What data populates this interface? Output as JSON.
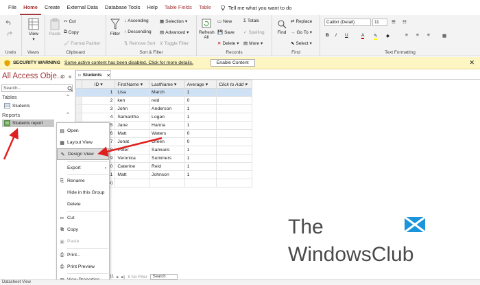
{
  "menu": {
    "items": [
      "File",
      "Home",
      "Create",
      "External Data",
      "Database Tools",
      "Help",
      "Table Fields",
      "Table"
    ],
    "active": "Home",
    "tell_me": "Tell me what you want to do"
  },
  "ribbon": {
    "undo": {
      "label": "Undo"
    },
    "views": {
      "view_label": "View",
      "label": "Views"
    },
    "clipboard": {
      "paste": "Paste",
      "cut": "Cut",
      "copy": "Copy",
      "format_painter": "Format Painter",
      "label": "Clipboard"
    },
    "sort_filter": {
      "filter": "Filter",
      "ascending": "Ascending",
      "descending": "Descending",
      "remove_sort": "Remove Sort",
      "selection": "Selection",
      "advanced": "Advanced",
      "toggle_filter": "Toggle Filter",
      "label": "Sort & Filter"
    },
    "records": {
      "refresh": "Refresh",
      "refresh_all": "All",
      "new": "New",
      "save": "Save",
      "delete": "Delete",
      "totals": "Totals",
      "spelling": "Spelling",
      "more": "More",
      "label": "Records"
    },
    "find": {
      "find": "Find",
      "replace": "Replace",
      "goto": "Go To",
      "select": "Select",
      "label": "Find"
    },
    "text_formatting": {
      "font": "Calibri (Detail)",
      "size": "11",
      "bold": "B",
      "italic": "I",
      "underline": "U",
      "font_color": "A",
      "label": "Text Formatting"
    }
  },
  "security": {
    "title": "SECURITY WARNING",
    "message": "Some active content has been disabled. Click for more details.",
    "enable_button": "Enable Content"
  },
  "nav": {
    "title": "All Access Obje...",
    "search_placeholder": "Search...",
    "groups": [
      {
        "name": "Tables",
        "items": [
          "Students"
        ]
      },
      {
        "name": "Reports",
        "items": [
          "Students report"
        ]
      }
    ]
  },
  "document": {
    "tab_label": "Students",
    "columns": [
      "ID",
      "FirstName",
      "LastName",
      "Average",
      "Click to Add"
    ],
    "rows": [
      {
        "id": "1",
        "first": "Lisa",
        "last": "March",
        "avg": "1"
      },
      {
        "id": "2",
        "first": "ken",
        "last": "reid",
        "avg": "0"
      },
      {
        "id": "3",
        "first": "John",
        "last": "Anderson",
        "avg": "1"
      },
      {
        "id": "4",
        "first": "Samantha",
        "last": "Logan",
        "avg": "1"
      },
      {
        "id": "5",
        "first": "Jane",
        "last": "Hanna",
        "avg": "1"
      },
      {
        "id": "6",
        "first": "Matt",
        "last": "Waters",
        "avg": "0"
      },
      {
        "id": "7",
        "first": "Jonat",
        "last": "Green",
        "avg": "0"
      },
      {
        "id": "8",
        "first": "Peter",
        "last": "Samuels",
        "avg": "1"
      },
      {
        "id": "9",
        "first": "Veronica",
        "last": "Summers",
        "avg": "1"
      },
      {
        "id": "10",
        "first": "Caterine",
        "last": "Reid",
        "avg": "1"
      },
      {
        "id": "11",
        "first": "Matt",
        "last": "Johnson",
        "avg": "1"
      }
    ],
    "new_row_marker": "w)"
  },
  "context_menu": {
    "items": [
      {
        "label": "Open",
        "icon": "open-icon"
      },
      {
        "label": "Layout View",
        "icon": "layout-view-icon"
      },
      {
        "label": "Design View",
        "icon": "design-view-icon"
      },
      {
        "label": "Export",
        "icon": ""
      },
      {
        "label": "Rename",
        "icon": "rename-icon"
      },
      {
        "label": "Hide in this Group",
        "icon": ""
      },
      {
        "label": "Delete",
        "icon": ""
      },
      {
        "label": "Cut",
        "icon": "scissors-icon"
      },
      {
        "label": "Copy",
        "icon": "copy-icon"
      },
      {
        "label": "Paste",
        "icon": "paste-icon"
      },
      {
        "label": "Print...",
        "icon": "print-icon"
      },
      {
        "label": "Print Preview",
        "icon": "print-preview-icon"
      },
      {
        "label": "View Properties",
        "icon": "properties-icon"
      }
    ],
    "highlighted": "Design View"
  },
  "record_nav": {
    "current": "11",
    "filter": "No Filter",
    "search": "Search"
  },
  "status": {
    "text": "Datasheet View"
  },
  "watermark": {
    "line1": "The",
    "line2": "WindowsClub"
  },
  "colors": {
    "accent": "#a4373a",
    "warning_bg": "#fdf6c3",
    "selection": "#cfe2f5",
    "arrow": "#e02020"
  }
}
